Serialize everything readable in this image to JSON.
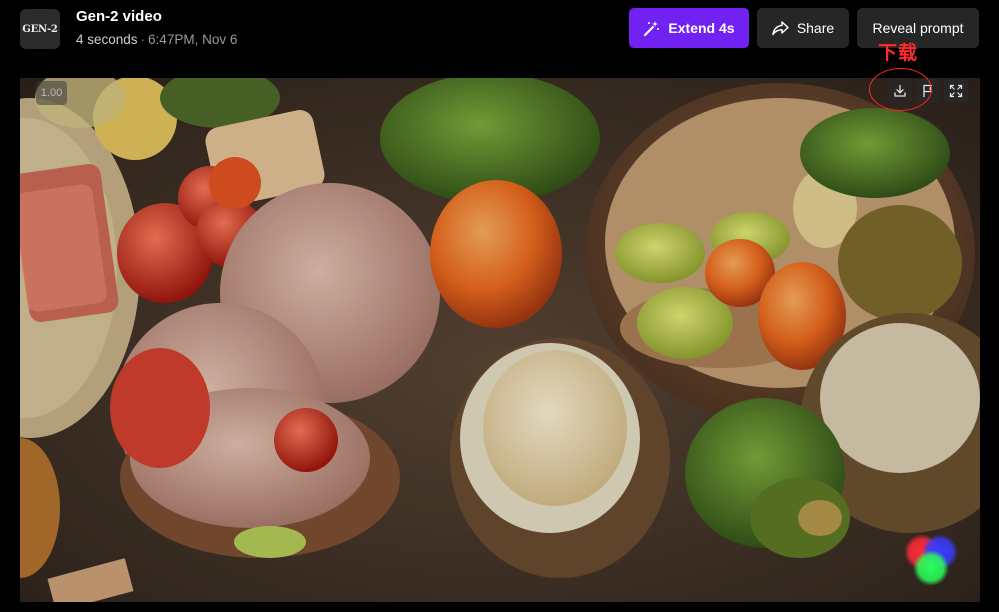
{
  "header": {
    "logo_text": "GEN-2",
    "title": "Gen-2 video",
    "duration": "4 seconds",
    "separator": "·",
    "timestamp": "6:47PM, Nov 6"
  },
  "actions": {
    "extend_label": "Extend 4s",
    "share_label": "Share",
    "reveal_label": "Reveal prompt"
  },
  "annotation": {
    "label": "下载"
  },
  "player": {
    "speed": "1.00",
    "download_icon": "download-icon",
    "flag_icon": "flag-icon",
    "fullscreen_icon": "fullscreen-icon"
  },
  "colors": {
    "accent": "#7122f2",
    "button_bg": "#262626",
    "annotation": "#ff2222"
  }
}
